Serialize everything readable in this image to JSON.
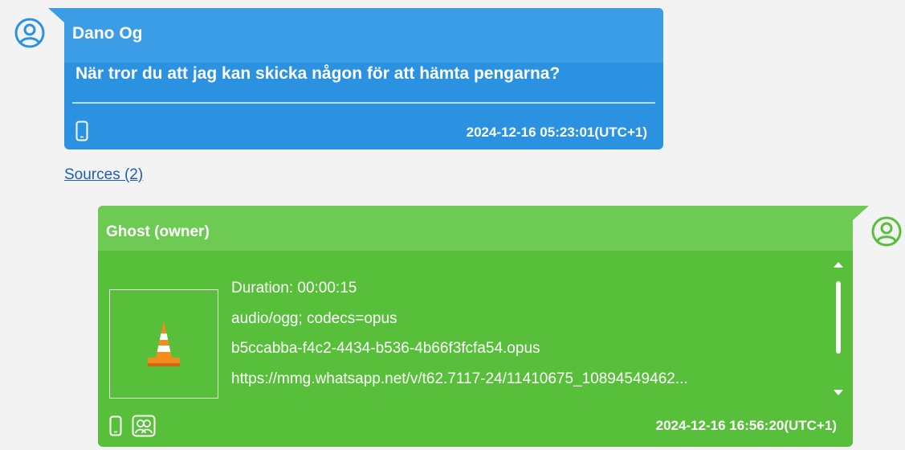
{
  "conversation": {
    "incoming": {
      "sender": "Dano Og",
      "text": "När tror du att jag kan skicka någon för att hämta pengarna?",
      "timestamp": "2024-12-16 05:23:01(UTC+1)",
      "device_icon": "phone-icon",
      "color": "#2a92e0"
    },
    "sources_link": "Sources (2)",
    "outgoing": {
      "sender": "Ghost (owner)",
      "attachment": {
        "thumbnail_icon": "vlc-cone-icon",
        "duration": "Duration: 00:00:15",
        "mime": "audio/ogg; codecs=opus",
        "filename": "b5ccabba-f4c2-4434-b536-4b66f3fcfa54.opus",
        "url": "https://mmg.whatsapp.net/v/t62.7117-24/11410675_10894549462..."
      },
      "timestamp": "2024-12-16 16:56:20(UTC+1)",
      "footer_icons": [
        "phone-icon",
        "contacts-icon"
      ],
      "color": "#58bf3a"
    },
    "avatar_colors": {
      "incoming": "#2a92e0",
      "outgoing": "#58bf3a"
    }
  }
}
